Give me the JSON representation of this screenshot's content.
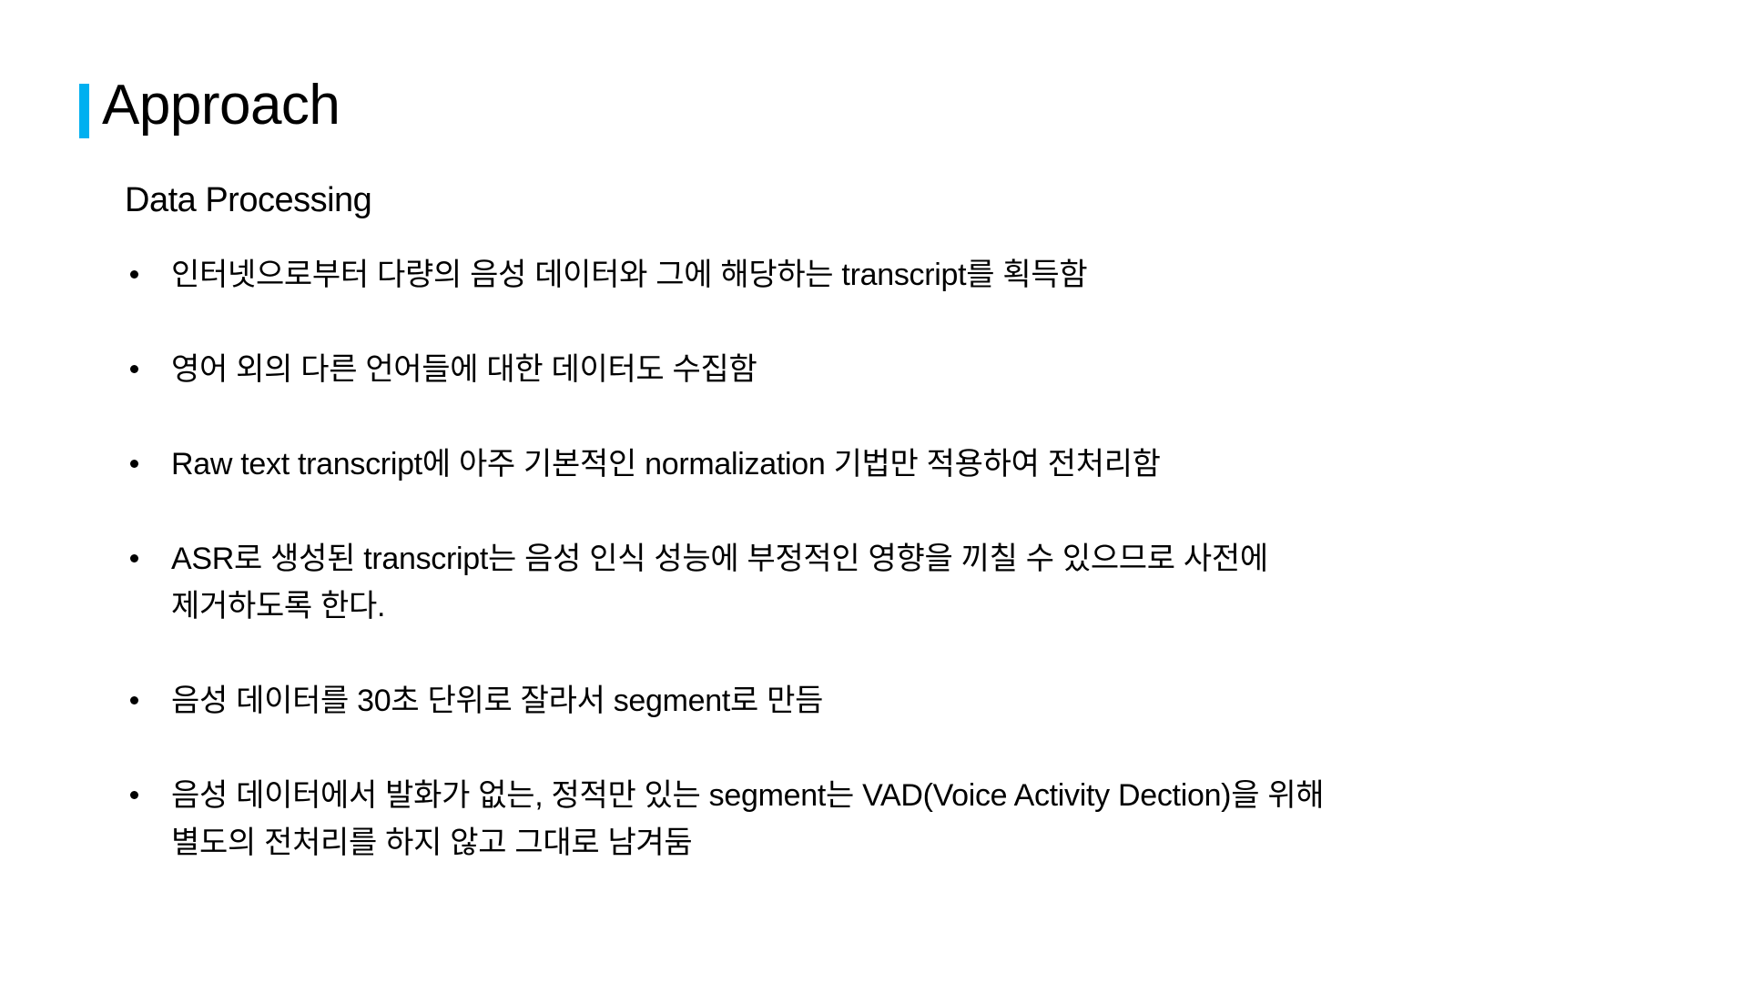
{
  "slide": {
    "title": "Approach",
    "accent_color": "#00B0F0",
    "subtitle": "Data Processing",
    "bullets": [
      {
        "lines": [
          "인터넷으로부터 다량의 음성 데이터와 그에 해당하는 transcript를 획득함"
        ]
      },
      {
        "lines": [
          "영어 외의 다른 언어들에 대한 데이터도 수집함"
        ]
      },
      {
        "lines": [
          "Raw text transcript에 아주 기본적인 normalization 기법만 적용하여 전처리함"
        ]
      },
      {
        "lines": [
          "ASR로 생성된 transcript는 음성 인식 성능에 부정적인 영향을 끼칠 수 있으므로 사전에",
          "제거하도록 한다."
        ]
      },
      {
        "lines": [
          "음성 데이터를 30초 단위로 잘라서 segment로 만듬"
        ]
      },
      {
        "lines": [
          "음성 데이터에서 발화가 없는, 정적만 있는 segment는 VAD(Voice Activity Dection)을 위해",
          "별도의 전처리를 하지 않고 그대로 남겨둠"
        ]
      }
    ]
  }
}
